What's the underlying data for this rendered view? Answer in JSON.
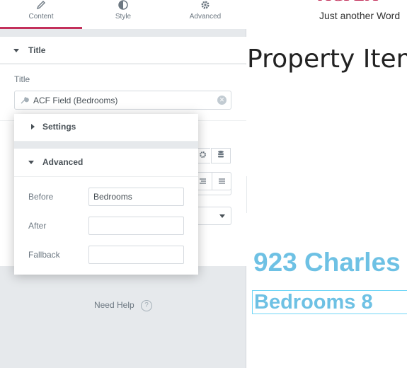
{
  "tabs": [
    {
      "label": "Content",
      "icon": "pencil-icon",
      "active": true
    },
    {
      "label": "Style",
      "icon": "half-circle-icon",
      "active": false
    },
    {
      "label": "Advanced",
      "icon": "gear-icon",
      "active": false
    }
  ],
  "section": {
    "title": "Title"
  },
  "title_control": {
    "label": "Title",
    "dynamic_value": "ACF Field (Bedrooms)"
  },
  "popover": {
    "settings_label": "Settings",
    "advanced_label": "Advanced",
    "fields": [
      {
        "label": "Before",
        "value": "Bedrooms"
      },
      {
        "label": "After",
        "value": ""
      },
      {
        "label": "Fallback",
        "value": ""
      }
    ]
  },
  "help": {
    "label": "Need Help",
    "icon": "question-icon"
  },
  "preview": {
    "site_title": "ACPLA",
    "site_tagline": "Just another Word",
    "page_title": "Property Item",
    "heading": "923 Charles",
    "bedrooms_text": "Bedrooms 8"
  },
  "colors": {
    "accent": "#c3305b",
    "heading": "#6ec1e4",
    "panel_bg": "#e6e9ec"
  }
}
